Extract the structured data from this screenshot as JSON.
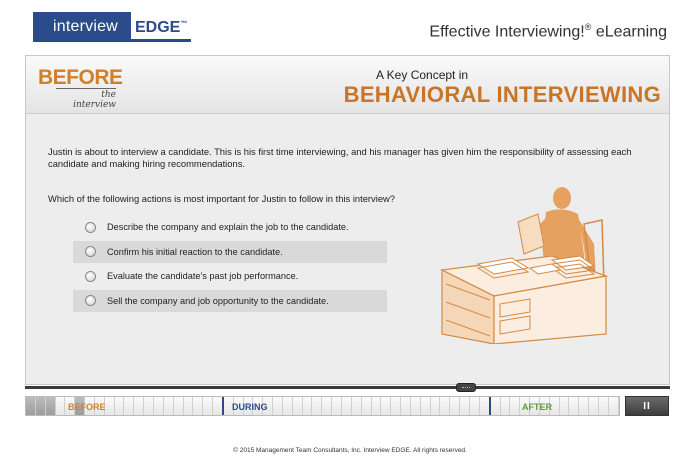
{
  "header": {
    "logo_part1": "interview",
    "logo_part2": "EDGE",
    "logo_tm": "™",
    "app_title": "Effective Interviewing!",
    "app_title_reg": "®",
    "app_title_suffix": " eLearning"
  },
  "banner": {
    "section_word": "BEFORE",
    "section_sub": "the interview",
    "concept_small": "A Key Concept in",
    "concept_big": "BEHAVIORAL INTERVIEWING"
  },
  "content": {
    "scenario": "Justin is about to interview a candidate. This is his first time interviewing, and his manager has given him the responsibility of assessing each candidate and making hiring recommendations.",
    "question": "Which of the following actions is most important for Justin to follow in this interview?",
    "options": [
      {
        "label": "Describe the company and explain the job to the candidate."
      },
      {
        "label": "Confirm his initial reaction to the candidate."
      },
      {
        "label": "Evaluate the candidate's past job performance."
      },
      {
        "label": "Sell the company and job opportunity to the candidate."
      }
    ]
  },
  "timeline": {
    "before": "BEFORE",
    "during": "DURING",
    "after": "AFTER",
    "pause_label": "II"
  },
  "footer": {
    "copyright": "© 2015 Management Team Consultants, Inc. Interview EDGE. All rights reserved."
  },
  "colors": {
    "brand_blue": "#2b4b8a",
    "accent_orange": "#c87528",
    "after_green": "#5a9a3a"
  }
}
